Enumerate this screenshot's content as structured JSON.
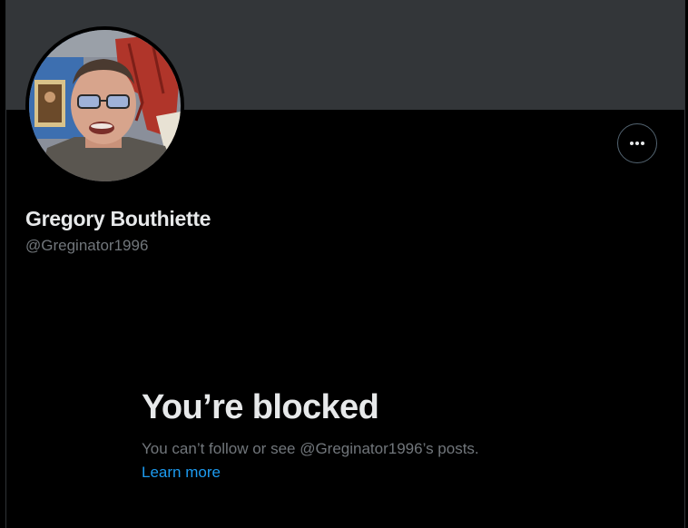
{
  "profile": {
    "display_name": "Gregory Bouthiette",
    "handle": "@Greginator1996"
  },
  "header": {
    "banner_color": "#333639",
    "more_icon": "ellipsis-horizontal-icon"
  },
  "blocked": {
    "title": "You’re blocked",
    "description": "You can’t follow or see @Greginator1996’s posts.",
    "learn_more": "Learn more"
  },
  "colors": {
    "background": "#000000",
    "primary_text": "#e7e9ea",
    "secondary_text": "#71767b",
    "link": "#1d9bf0",
    "border": "#536471"
  }
}
